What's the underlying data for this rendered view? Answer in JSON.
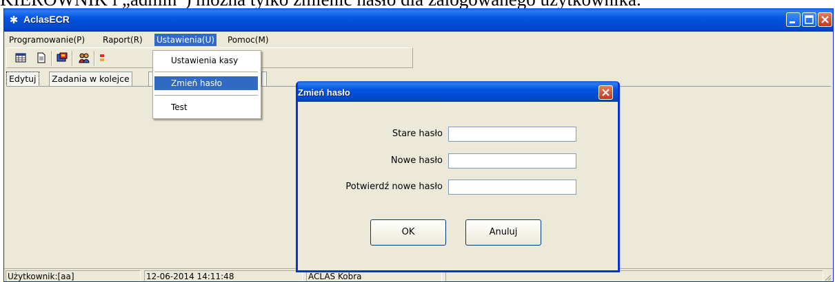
{
  "document_text": "KIEROWNIK i „admin”) można tylko zmienić hasło dla zalogowanego użytkownika.",
  "window": {
    "title": "AclasECR",
    "icon": "app-logo-icon"
  },
  "menubar": [
    {
      "label": "Programowanie(P)"
    },
    {
      "label": "Raport(R)"
    },
    {
      "label": "Ustawienia(U)"
    },
    {
      "label": "Pomoc(M)"
    }
  ],
  "toolbar": {
    "icons": [
      "table-icon",
      "document-icon",
      "card-icon",
      "users-icon",
      "settings-icon"
    ]
  },
  "tabs": [
    {
      "label": "Edytuj"
    },
    {
      "label": "Zadania w kolejce"
    }
  ],
  "dropdown": {
    "items": [
      {
        "label": "Ustawienia kasy"
      },
      {
        "label": "Zmień hasło"
      },
      {
        "label": "Test"
      }
    ]
  },
  "dialog": {
    "title": "Zmień hasło",
    "fields": [
      {
        "label": "Stare hasło",
        "value": ""
      },
      {
        "label": "Nowe hasło",
        "value": ""
      },
      {
        "label": "Potwierdź nowe hasło",
        "value": ""
      }
    ],
    "ok_label": "OK",
    "cancel_label": "Anuluj"
  },
  "statusbar": {
    "user": "Użytkownik:[aa]",
    "datetime": "12-06-2014 14:11:48",
    "model": "ACLAS Kobra"
  },
  "colors": {
    "titlebar_blue": "#0554e3",
    "highlight": "#316ac5",
    "close_red": "#c6361b",
    "window_bg": "#ece9d8"
  }
}
